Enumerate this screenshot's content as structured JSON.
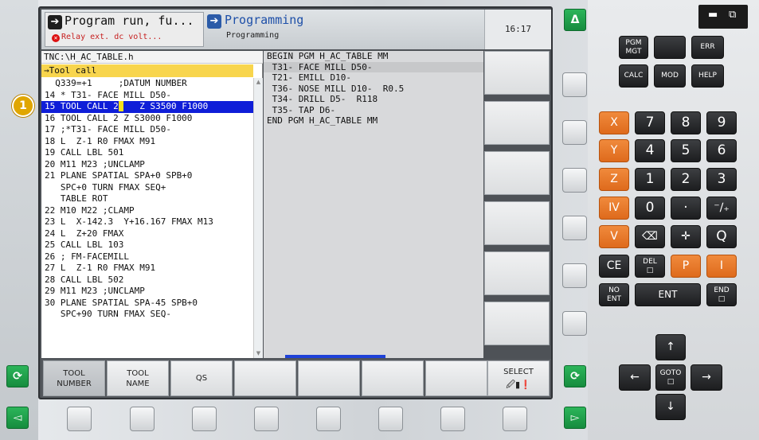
{
  "header": {
    "mode_a_title": "Program run, fu...",
    "mode_a_error": "Relay ext. dc volt...",
    "mode_b_title": "Programming",
    "mode_b_sub": "Programming",
    "time": "16:17"
  },
  "program": {
    "path": "TNC:\\H_AC_TABLE.h",
    "find": "→Tool call",
    "lines": [
      "  Q339=+1     ;DATUM NUMBER",
      "14 * T31- FACE MILL D50-",
      "15 TOOL CALL 2",
      "16 TOOL CALL 2 Z S3000 F1000",
      "17 ;*T31- FACE MILL D50-",
      "18 L  Z-1 R0 FMAX M91",
      "19 CALL LBL 501",
      "20 M11 M23 ;UNCLAMP",
      "21 PLANE SPATIAL SPA+0 SPB+0",
      "   SPC+0 TURN FMAX SEQ+",
      "   TABLE ROT",
      "22 M10 M22 ;CLAMP",
      "23 L  X-142.3  Y+16.167 FMAX M13",
      "24 L  Z+20 FMAX",
      "25 CALL LBL 103",
      "26 ; FM-FACEMILL",
      "27 L  Z-1 R0 FMAX M91",
      "28 CALL LBL 502",
      "29 M11 M23 ;UNCLAMP",
      "30 PLANE SPATIAL SPA-45 SPB+0",
      "   SPC+90 TURN FMAX SEQ-"
    ],
    "selected_rest": "   Z S3500 F1000"
  },
  "toolpgm": {
    "lines": [
      "BEGIN PGM H_AC_TABLE MM",
      " T31- FACE MILL D50-",
      " T21- EMILL D10-",
      " T36- NOSE MILL D10-  R0.5",
      " T34- DRILL D5-  R118",
      " T35- TAP D6-",
      "END PGM H_AC_TABLE MM"
    ]
  },
  "softkeys": {
    "tool_number_l1": "TOOL",
    "tool_number_l2": "NUMBER",
    "tool_name_l1": "TOOL",
    "tool_name_l2": "NAME",
    "qs": "QS",
    "select": "SELECT"
  },
  "badge": "1",
  "keypad": {
    "pgm_mgt_l1": "PGM",
    "pgm_mgt_l2": "MGT",
    "err": "ERR",
    "calc": "CALC",
    "mod": "MOD",
    "help": "HELP",
    "x": "X",
    "y": "Y",
    "z": "Z",
    "iv": "IV",
    "v": "V",
    "n7": "7",
    "n8": "8",
    "n9": "9",
    "n4": "4",
    "n5": "5",
    "n6": "6",
    "n1": "1",
    "n2": "2",
    "n3": "3",
    "n0": "0",
    "dot": "·",
    "plusminus": "⁻∕₊",
    "q": "Q",
    "ce": "CE",
    "del": "DEL",
    "p": "P",
    "i": "I",
    "no_ent_l1": "NO",
    "no_ent_l2": "ENT",
    "ent": "ENT",
    "end": "END",
    "goto": "GOTO"
  }
}
